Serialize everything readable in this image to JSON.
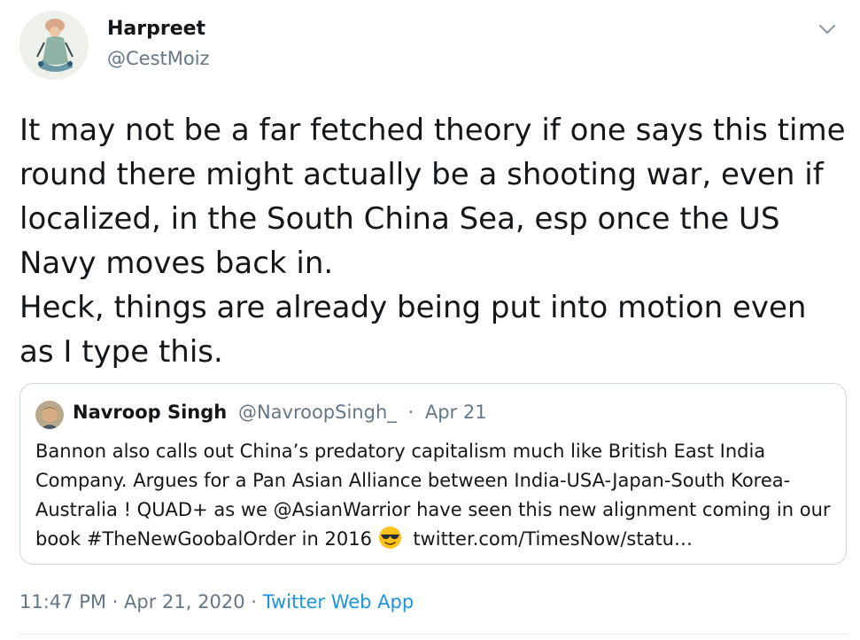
{
  "author": {
    "name": "Harpreet",
    "handle": "@CestMoiz"
  },
  "tweet": {
    "text": "It may not be a far fetched theory if one says this time round there might actually be a shooting war, even if localized, in the South China Sea, esp once the US Navy moves back in.\nHeck, things are already being put into motion even as I type this."
  },
  "quoted_tweet": {
    "name": "Navroop Singh",
    "handle": "@NavroopSingh_",
    "separator": "·",
    "date": "Apr 21",
    "text_before_emoji": "Bannon also calls out China’s predatory capitalism much like British East India Company. Argues for a Pan Asian Alliance between India-USA-Japan-South Korea-Australia ! QUAD+ as we @AsianWarrior have seen this new alignment coming in our book #TheNewGoobalOrder in 2016",
    "emoji": "smiling-face-with-sunglasses",
    "link_text": "twitter.com/TimesNow/statu…"
  },
  "meta": {
    "time": "11:47 PM",
    "separator": "·",
    "date": "Apr 21, 2020",
    "app": "Twitter Web App"
  },
  "colors": {
    "text": "#14171a",
    "secondary": "#657786",
    "link": "#1b95e0",
    "border": "#ccd6dd"
  }
}
